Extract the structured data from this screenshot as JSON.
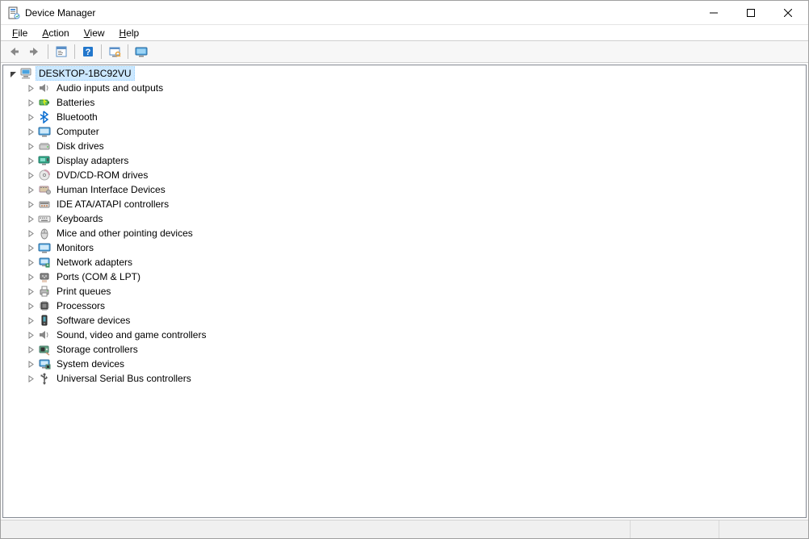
{
  "window": {
    "title": "Device Manager"
  },
  "menubar": {
    "file": "File",
    "action": "Action",
    "view": "View",
    "help": "Help"
  },
  "toolbar": {
    "back": "Back",
    "forward": "Forward",
    "properties": "Properties",
    "help": "Help",
    "scan": "Scan for hardware changes",
    "monitor": "Show hidden devices"
  },
  "tree": {
    "root": {
      "label": "DESKTOP-1BC92VU",
      "expanded": true,
      "selected": true
    },
    "categories": [
      {
        "label": "Audio inputs and outputs",
        "icon": "speaker"
      },
      {
        "label": "Batteries",
        "icon": "battery"
      },
      {
        "label": "Bluetooth",
        "icon": "bluetooth"
      },
      {
        "label": "Computer",
        "icon": "monitor"
      },
      {
        "label": "Disk drives",
        "icon": "disk"
      },
      {
        "label": "Display adapters",
        "icon": "display-adapter"
      },
      {
        "label": "DVD/CD-ROM drives",
        "icon": "optical"
      },
      {
        "label": "Human Interface Devices",
        "icon": "hid"
      },
      {
        "label": "IDE ATA/ATAPI controllers",
        "icon": "ide"
      },
      {
        "label": "Keyboards",
        "icon": "keyboard"
      },
      {
        "label": "Mice and other pointing devices",
        "icon": "mouse"
      },
      {
        "label": "Monitors",
        "icon": "monitor"
      },
      {
        "label": "Network adapters",
        "icon": "network"
      },
      {
        "label": "Ports (COM & LPT)",
        "icon": "port"
      },
      {
        "label": "Print queues",
        "icon": "printer"
      },
      {
        "label": "Processors",
        "icon": "cpu"
      },
      {
        "label": "Software devices",
        "icon": "software"
      },
      {
        "label": "Sound, video and game controllers",
        "icon": "speaker"
      },
      {
        "label": "Storage controllers",
        "icon": "storage"
      },
      {
        "label": "System devices",
        "icon": "system"
      },
      {
        "label": "Universal Serial Bus controllers",
        "icon": "usb"
      }
    ]
  }
}
